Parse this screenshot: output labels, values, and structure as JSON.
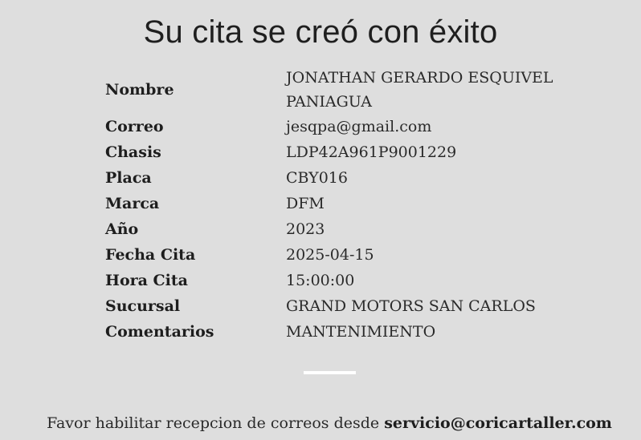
{
  "title": "Su cita se creó con éxito",
  "details": [
    {
      "label": "Nombre",
      "value": "JONATHAN GERARDO ESQUIVEL PANIAGUA"
    },
    {
      "label": "Correo",
      "value": "jesqpa@gmail.com"
    },
    {
      "label": "Chasis",
      "value": "LDP42A961P9001229"
    },
    {
      "label": "Placa",
      "value": "CBY016"
    },
    {
      "label": "Marca",
      "value": "DFM"
    },
    {
      "label": "Año",
      "value": "2023"
    },
    {
      "label": "Fecha Cita",
      "value": "2025-04-15"
    },
    {
      "label": "Hora Cita",
      "value": "15:00:00"
    },
    {
      "label": "Sucursal",
      "value": "GRAND MOTORS SAN CARLOS"
    },
    {
      "label": "Comentarios",
      "value": "MANTENIMIENTO"
    }
  ],
  "note": {
    "text": "Favor habilitar recepcion de correos desde ",
    "email": "servicio@coricartaller.com"
  },
  "colors": {
    "background": "#dedede",
    "divider": "#ffffff"
  }
}
